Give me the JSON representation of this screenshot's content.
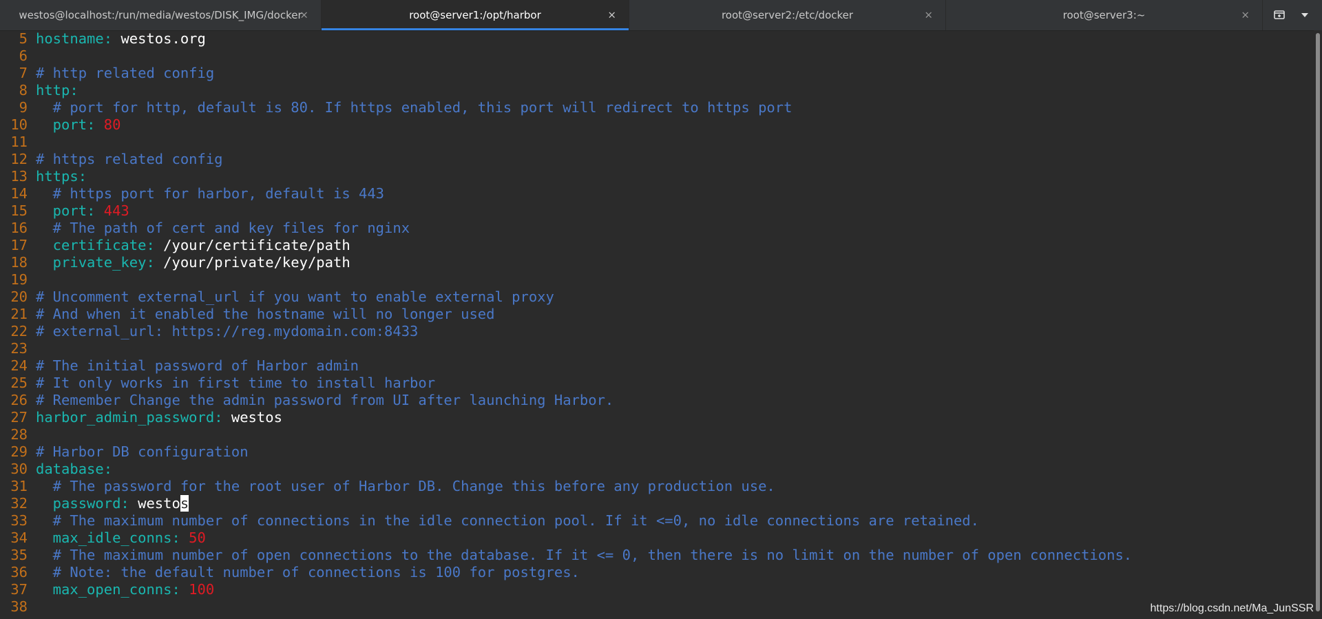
{
  "tabs": [
    {
      "label": "westos@localhost:/run/media/westos/DISK_IMG/docker",
      "close": "×"
    },
    {
      "label": "root@server1:/opt/harbor",
      "close": "×"
    },
    {
      "label": "root@server2:/etc/docker",
      "close": "×"
    },
    {
      "label": "root@server3:~",
      "close": "×"
    }
  ],
  "tab_actions": {
    "new_tab_icon": "new-tab-icon",
    "menu_icon": "chevron-down-icon"
  },
  "lines": [
    {
      "num": "5",
      "parts": [
        {
          "t": "hostname",
          "c": "k"
        },
        {
          "t": ": ",
          "c": "k"
        },
        {
          "t": "westos.org",
          "c": "s"
        }
      ]
    },
    {
      "num": "6",
      "parts": []
    },
    {
      "num": "7",
      "parts": [
        {
          "t": "# http related config",
          "c": "c"
        }
      ]
    },
    {
      "num": "8",
      "parts": [
        {
          "t": "http:",
          "c": "k"
        }
      ]
    },
    {
      "num": "9",
      "parts": [
        {
          "t": "  # port for http, default is 80. If https enabled, this port will redirect to https port",
          "c": "c"
        }
      ]
    },
    {
      "num": "10",
      "parts": [
        {
          "t": "  port",
          "c": "k"
        },
        {
          "t": ": ",
          "c": "k"
        },
        {
          "t": "80",
          "c": "n"
        }
      ]
    },
    {
      "num": "11",
      "parts": []
    },
    {
      "num": "12",
      "parts": [
        {
          "t": "# https related config",
          "c": "c"
        }
      ]
    },
    {
      "num": "13",
      "parts": [
        {
          "t": "https:",
          "c": "k"
        }
      ]
    },
    {
      "num": "14",
      "parts": [
        {
          "t": "  # https port for harbor, default is 443",
          "c": "c"
        }
      ]
    },
    {
      "num": "15",
      "parts": [
        {
          "t": "  port",
          "c": "k"
        },
        {
          "t": ": ",
          "c": "k"
        },
        {
          "t": "443",
          "c": "n"
        }
      ]
    },
    {
      "num": "16",
      "parts": [
        {
          "t": "  # The path of cert and key files for nginx",
          "c": "c"
        }
      ]
    },
    {
      "num": "17",
      "parts": [
        {
          "t": "  certificate",
          "c": "k"
        },
        {
          "t": ": ",
          "c": "k"
        },
        {
          "t": "/your/certificate/path",
          "c": "s"
        }
      ]
    },
    {
      "num": "18",
      "parts": [
        {
          "t": "  private_key",
          "c": "k"
        },
        {
          "t": ": ",
          "c": "k"
        },
        {
          "t": "/your/private/key/path",
          "c": "s"
        }
      ]
    },
    {
      "num": "19",
      "parts": []
    },
    {
      "num": "20",
      "parts": [
        {
          "t": "# Uncomment external_url if you want to enable external proxy",
          "c": "c"
        }
      ]
    },
    {
      "num": "21",
      "parts": [
        {
          "t": "# And when it enabled the hostname will no longer used",
          "c": "c"
        }
      ]
    },
    {
      "num": "22",
      "parts": [
        {
          "t": "# external_url: https://reg.mydomain.com:8433",
          "c": "c"
        }
      ]
    },
    {
      "num": "23",
      "parts": []
    },
    {
      "num": "24",
      "parts": [
        {
          "t": "# The initial password of Harbor admin",
          "c": "c"
        }
      ]
    },
    {
      "num": "25",
      "parts": [
        {
          "t": "# It only works in first time to install harbor",
          "c": "c"
        }
      ]
    },
    {
      "num": "26",
      "parts": [
        {
          "t": "# Remember Change the admin password from UI after launching Harbor.",
          "c": "c"
        }
      ]
    },
    {
      "num": "27",
      "parts": [
        {
          "t": "harbor_admin_password",
          "c": "k"
        },
        {
          "t": ": ",
          "c": "k"
        },
        {
          "t": "westos",
          "c": "s"
        }
      ]
    },
    {
      "num": "28",
      "parts": []
    },
    {
      "num": "29",
      "parts": [
        {
          "t": "# Harbor DB configuration",
          "c": "c"
        }
      ]
    },
    {
      "num": "30",
      "parts": [
        {
          "t": "database:",
          "c": "k"
        }
      ]
    },
    {
      "num": "31",
      "parts": [
        {
          "t": "  # The password for the root user of Harbor DB. Change this before any production use.",
          "c": "c"
        }
      ]
    },
    {
      "num": "32",
      "parts": [
        {
          "t": "  password",
          "c": "k"
        },
        {
          "t": ": ",
          "c": "k"
        },
        {
          "t": "westo",
          "c": "s"
        },
        {
          "t": "s",
          "c": "cursor"
        }
      ]
    },
    {
      "num": "33",
      "parts": [
        {
          "t": "  # The maximum number of connections in the idle connection pool. If it <=0, no idle connections are retained.",
          "c": "c"
        }
      ]
    },
    {
      "num": "34",
      "parts": [
        {
          "t": "  max_idle_conns",
          "c": "k"
        },
        {
          "t": ": ",
          "c": "k"
        },
        {
          "t": "50",
          "c": "n"
        }
      ]
    },
    {
      "num": "35",
      "parts": [
        {
          "t": "  # The maximum number of open connections to the database. If it <= 0, then there is no limit on the number of open connections.",
          "c": "c"
        }
      ]
    },
    {
      "num": "36",
      "parts": [
        {
          "t": "  # Note: the default number of connections is 100 for postgres.",
          "c": "c"
        }
      ]
    },
    {
      "num": "37",
      "parts": [
        {
          "t": "  max_open_conns",
          "c": "k"
        },
        {
          "t": ": ",
          "c": "k"
        },
        {
          "t": "100",
          "c": "n"
        }
      ]
    },
    {
      "num": "38",
      "parts": []
    }
  ],
  "watermark": "https://blog.csdn.net/Ma_JunSSR"
}
